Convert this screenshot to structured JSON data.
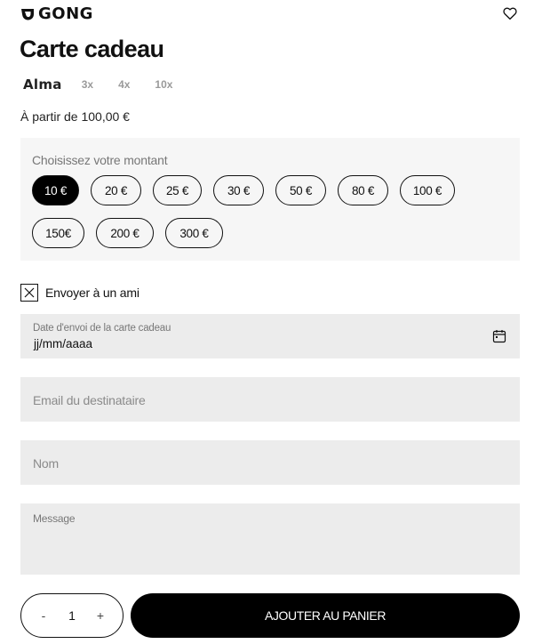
{
  "brand": {
    "logo_text": "GONG"
  },
  "product": {
    "title": "Carte cadeau",
    "price_from": "À partir de 100,00 €"
  },
  "alma": {
    "logo_text": "Alma",
    "options": [
      "3x",
      "4x",
      "10x"
    ]
  },
  "amount": {
    "label": "Choisissez votre montant",
    "options": [
      "10 €",
      "20 €",
      "25 €",
      "30 €",
      "50 €",
      "80 €",
      "100 €",
      "150€",
      "200 €",
      "300 €"
    ],
    "selected": "10 €"
  },
  "send_to_friend": {
    "label": "Envoyer à un ami",
    "checked": true
  },
  "form": {
    "date_label": "Date d'envoi de la carte cadeau",
    "date_value": "jj/mm/aaaa",
    "email_placeholder": "Email du destinataire",
    "name_placeholder": "Nom",
    "message_placeholder": "Message"
  },
  "cart": {
    "minus": "-",
    "quantity": "1",
    "plus": "+",
    "add_label": "AJOUTER AU PANIER"
  },
  "colors": {
    "primary": "#000000",
    "panel_bg": "#f6f6f6",
    "field_bg": "#ececec",
    "muted_text": "#8a8a8a"
  },
  "icons": [
    "gong-logo-icon",
    "heart-icon",
    "calendar-icon",
    "close-icon"
  ]
}
